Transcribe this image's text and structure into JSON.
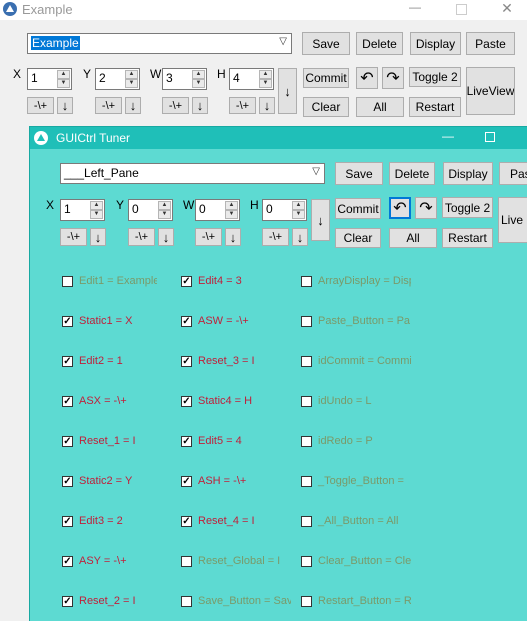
{
  "outer": {
    "title": "Example",
    "combo_value": "Example",
    "buttons": {
      "save": "Save",
      "delete": "Delete",
      "display": "Display",
      "paste": "Paste",
      "commit": "Commit",
      "toggle": "Toggle 2",
      "clear": "Clear",
      "all": "All",
      "restart": "Restart",
      "liveview": "LiveView"
    },
    "x": {
      "label": "X",
      "value": "1",
      "btn": "-\\+"
    },
    "y": {
      "label": "Y",
      "value": "2",
      "btn": "-\\+"
    },
    "w": {
      "label": "W",
      "value": "3",
      "btn": "-\\+"
    },
    "h": {
      "label": "H",
      "value": "4",
      "btn": "-\\+"
    }
  },
  "tuner": {
    "title": "GUICtrl Tuner",
    "combo_value": "___Left_Pane",
    "buttons": {
      "save": "Save",
      "delete": "Delete",
      "display": "Display",
      "paste": "Pas",
      "commit": "Commit",
      "toggle": "Toggle 2",
      "clear": "Clear",
      "all": "All",
      "restart": "Restart",
      "liveview": "Live"
    },
    "x": {
      "label": "X",
      "value": "1",
      "btn": "-\\+"
    },
    "y": {
      "label": "Y",
      "value": "0",
      "btn": "-\\+"
    },
    "w": {
      "label": "W",
      "value": "0",
      "btn": "-\\+"
    },
    "h": {
      "label": "H",
      "value": "0",
      "btn": "-\\+"
    },
    "col1": [
      {
        "text": "Edit1 = Example",
        "checked": false
      },
      {
        "text": "Static1 = X",
        "checked": true
      },
      {
        "text": "Edit2 = 1",
        "checked": true
      },
      {
        "text": "ASX = -\\+",
        "checked": true
      },
      {
        "text": "Reset_1 = I",
        "checked": true
      },
      {
        "text": "Static2 = Y",
        "checked": true
      },
      {
        "text": "Edit3 = 2",
        "checked": true
      },
      {
        "text": "ASY = -\\+",
        "checked": true
      },
      {
        "text": "Reset_2 = I",
        "checked": true
      }
    ],
    "col2": [
      {
        "text": "Edit4 = 3",
        "checked": true
      },
      {
        "text": "ASW = -\\+",
        "checked": true
      },
      {
        "text": "Reset_3 = I",
        "checked": true
      },
      {
        "text": "Static4 = H",
        "checked": true
      },
      {
        "text": "Edit5 = 4",
        "checked": true
      },
      {
        "text": "ASH = -\\+",
        "checked": true
      },
      {
        "text": "Reset_4 = I",
        "checked": true
      },
      {
        "text": "Reset_Global = I",
        "checked": false
      },
      {
        "text": "Save_Button = Sav",
        "checked": false
      }
    ],
    "col3": [
      {
        "text": "ArrayDisplay = Disp",
        "checked": false
      },
      {
        "text": "Paste_Button = Pa",
        "checked": false
      },
      {
        "text": "idCommit = Commit",
        "checked": false
      },
      {
        "text": "idUndo = L",
        "checked": false
      },
      {
        "text": "idRedo = P",
        "checked": false
      },
      {
        "text": "_Toggle_Button =",
        "checked": false
      },
      {
        "text": "_All_Button = All",
        "checked": false
      },
      {
        "text": "Clear_Button = Cle",
        "checked": false
      },
      {
        "text": "Restart_Button = R",
        "checked": false
      }
    ]
  },
  "colors": {
    "tuner_bg": "#5ddad2",
    "tuner_title": "#1fbfb8",
    "checked_text": "#c01f3a",
    "unchecked_text": "#7a9a6a"
  }
}
